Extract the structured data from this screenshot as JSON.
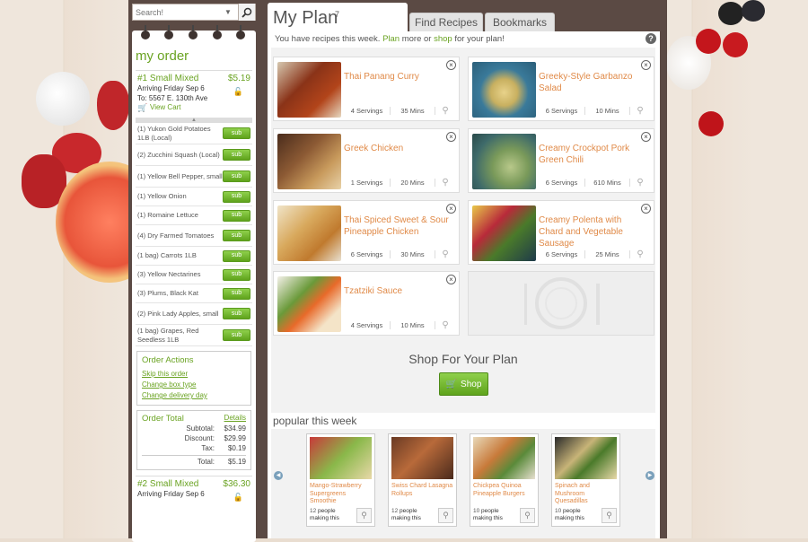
{
  "search": {
    "placeholder": "Search!"
  },
  "sidebar": {
    "title": "my order",
    "order1": {
      "name": "#1 Small Mixed",
      "price": "$5.19",
      "arriving": "Arriving Friday Sep 6",
      "to": "To: 5567 E. 130th Ave",
      "view_cart": "View Cart"
    },
    "items": [
      {
        "label": "(1) Yukon Gold Potatoes 1LB (Local)"
      },
      {
        "label": "(2) Zucchini Squash (Local)"
      },
      {
        "label": "(1) Yellow Bell Pepper, small"
      },
      {
        "label": "(1) Yellow Onion"
      },
      {
        "label": "(1) Romaine Lettuce"
      },
      {
        "label": "(4) Dry Farmed Tomatoes"
      },
      {
        "label": "(1 bag) Carrots 1LB"
      },
      {
        "label": "(3) Yellow Nectarines"
      },
      {
        "label": "(3) Plums, Black Kat"
      },
      {
        "label": "(2) Pink Lady Apples, small"
      },
      {
        "label": "(1 bag) Grapes, Red Seedless 1LB"
      }
    ],
    "sub_label": "sub",
    "order_actions": {
      "title": "Order Actions",
      "skip": "Skip this order",
      "change_box": "Change box type",
      "change_day": "Change delivery day"
    },
    "order_total": {
      "title": "Order Total",
      "details": "Details",
      "subtotal_label": "Subtotal:",
      "subtotal": "$34.99",
      "discount_label": "Discount:",
      "discount": "$29.99",
      "tax_label": "Tax:",
      "tax": "$0.19",
      "total_label": "Total:",
      "total": "$5.19"
    },
    "order2": {
      "name": "#2 Small Mixed",
      "price": "$36.30",
      "arriving": "Arriving Friday Sep 6"
    }
  },
  "tabs": {
    "my_plan": "My Plan",
    "my_plan_count": "7",
    "find_recipes": "Find Recipes",
    "bookmarks": "Bookmarks"
  },
  "info": {
    "pre": "You have recipes this week. ",
    "plan": "Plan",
    "mid": " more or ",
    "shop": "shop",
    "post": " for your plan!"
  },
  "recipes": [
    {
      "title": "Thai Panang Curry",
      "servings": "4 Servings",
      "mins": "35 Mins"
    },
    {
      "title": "Greeky-Style Garbanzo Salad",
      "servings": "6 Servings",
      "mins": "10 Mins"
    },
    {
      "title": "Greek Chicken",
      "servings": "1 Servings",
      "mins": "20 Mins"
    },
    {
      "title": "Creamy Crockpot Pork Green Chili",
      "servings": "6 Servings",
      "mins": "610 Mins"
    },
    {
      "title": "Thai Spiced Sweet & Sour Pineapple Chicken",
      "servings": "6 Servings",
      "mins": "30 Mins"
    },
    {
      "title": "Creamy Polenta with Chard and Vegetable Sausage",
      "servings": "6 Servings",
      "mins": "25 Mins"
    },
    {
      "title": "Tzatziki Sauce",
      "servings": "4 Servings",
      "mins": "10 Mins"
    }
  ],
  "shop_section": {
    "title": "Shop For Your Plan",
    "button": "Shop"
  },
  "popular": {
    "title": "popular this week",
    "items": [
      {
        "title": "Mango-Strawberry Supergreens Smoothie",
        "count": "12",
        "making": "people making this"
      },
      {
        "title": "Swiss Chard Lasagna Rollups",
        "count": "12",
        "making": "people making this"
      },
      {
        "title": "Chickpea Quinoa Pineapple Burgers",
        "count": "10",
        "making": "people making this"
      },
      {
        "title": "Spinach and Mushroom Quesadillas",
        "count": "10",
        "making": "people making this"
      }
    ]
  },
  "colors": {
    "accent_green": "#6aa322",
    "recipe_orange": "#e08a48",
    "frame_brown": "#5b4a44"
  }
}
